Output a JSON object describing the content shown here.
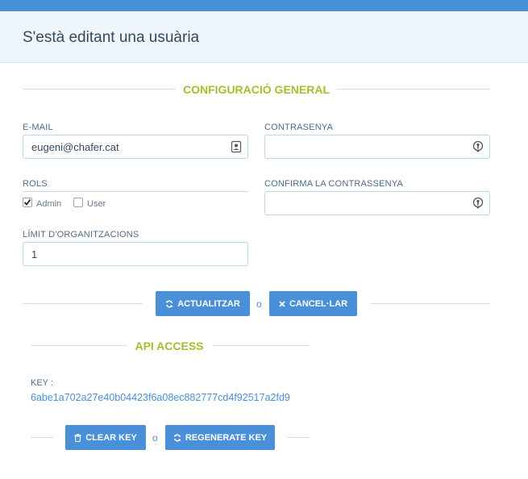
{
  "header": {
    "title": "S'està editant una usuària"
  },
  "general": {
    "section_title": "CONFIGURACIÓ GENERAL",
    "email": {
      "label": "E-MAIL",
      "value": "eugeni@chafer.cat",
      "icon": "contact-card-icon"
    },
    "password": {
      "label": "CONTRASENYA",
      "value": "",
      "icon": "password-key-icon"
    },
    "password_confirm": {
      "label": "CONFIRMA LA CONTRASSENYA",
      "value": "",
      "icon": "password-key-icon"
    },
    "roles": {
      "label": "ROLS",
      "options": [
        {
          "label": "Admin",
          "checked": true
        },
        {
          "label": "User",
          "checked": false
        }
      ]
    },
    "org_limit": {
      "label": "LÍMIT D'ORGANITZACIONS",
      "value": "1"
    }
  },
  "actions": {
    "update_label": "ACTUALITZAR",
    "or_label": "o",
    "cancel_label": "CANCEL·LAR"
  },
  "api": {
    "section_title": "API ACCESS",
    "key_label": "KEY :",
    "key_value": "6abe1a702a27e40b04423f6a08ec882777cd4f92517a2fd9",
    "clear_label": "CLEAR KEY",
    "or_label": "o",
    "regenerate_label": "REGENERATE KEY"
  },
  "colors": {
    "accent": "#4a90d9",
    "section_title": "#a4bf2c",
    "header_bg": "#eef5fc",
    "label": "#4d6d8a"
  }
}
